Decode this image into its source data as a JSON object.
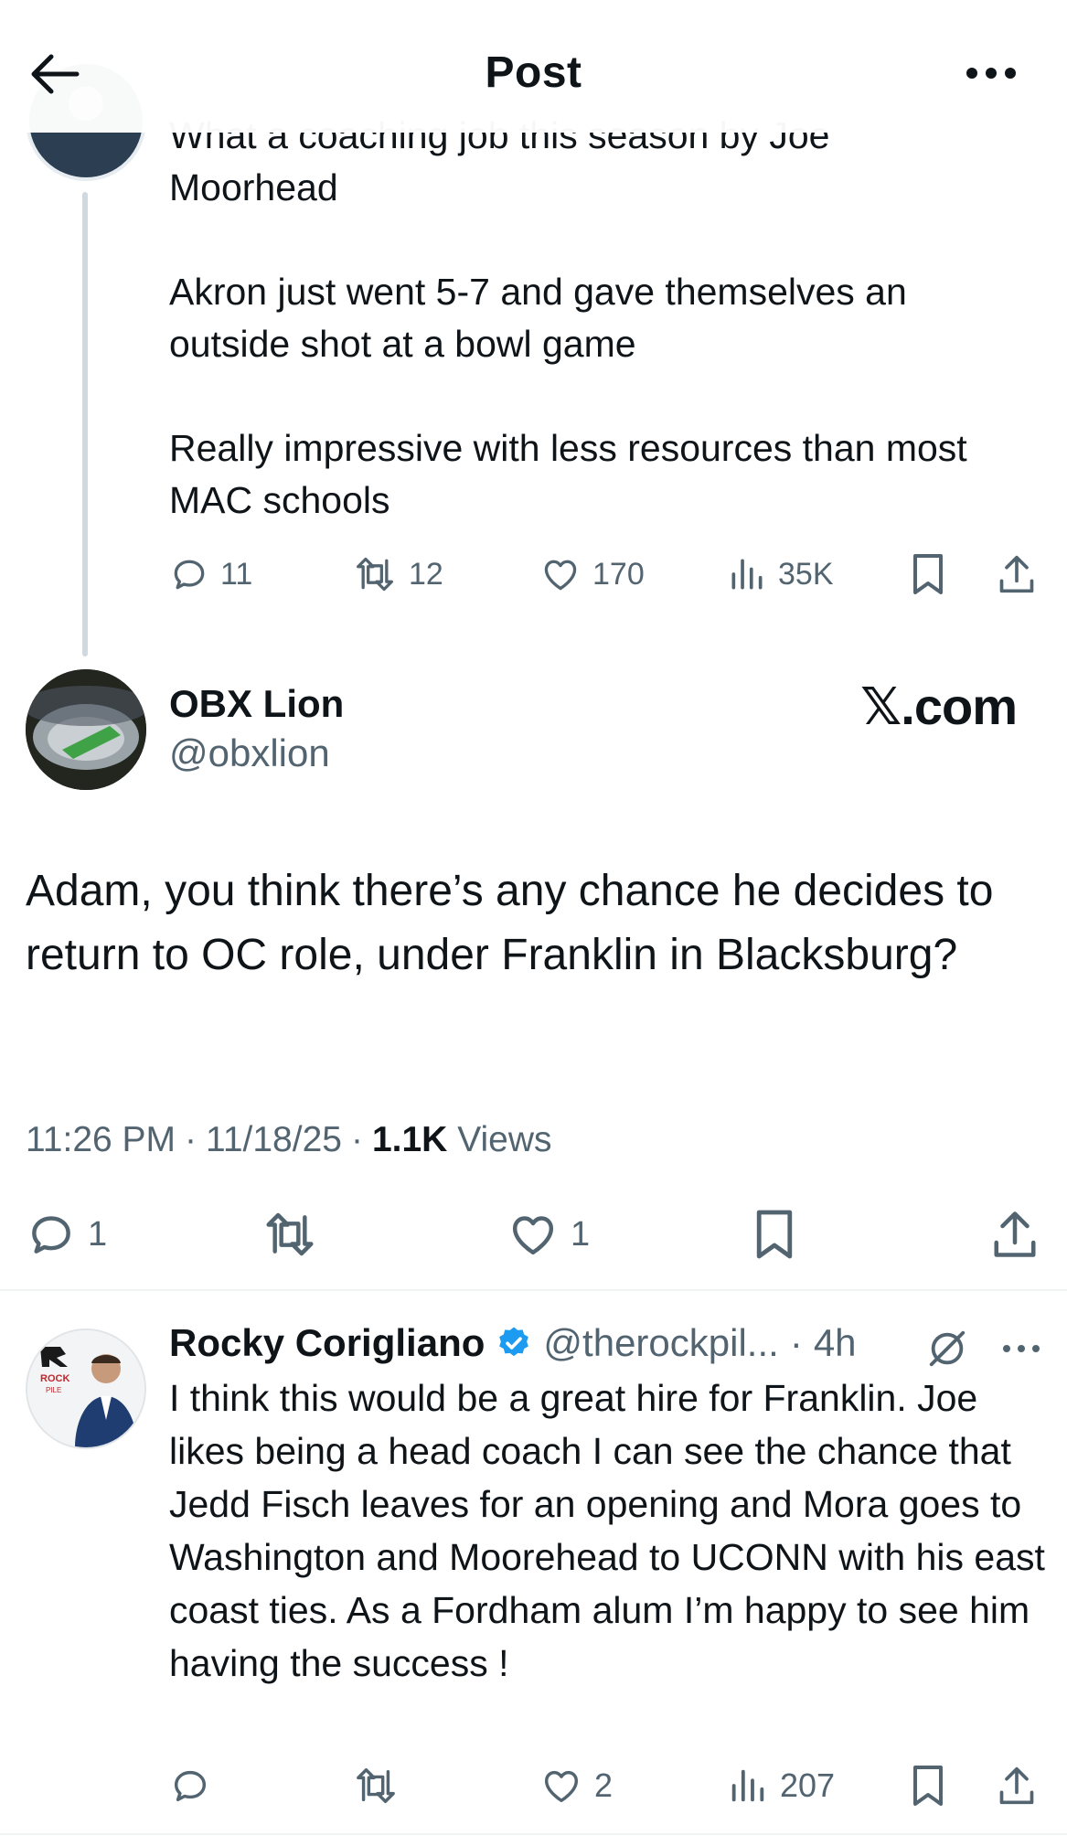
{
  "header": {
    "title": "Post"
  },
  "parent_tweet": {
    "text_lines": "What a coaching job this season by Joe\nMoorhead\n\nAkron just went 5-7 and gave themselves an\noutside shot at a bowl game\n\nReally impressive with less resources than most\nMAC schools",
    "stats": {
      "replies": "11",
      "reposts": "12",
      "likes": "170",
      "views": "35K"
    }
  },
  "focused_tweet": {
    "display_name": "OBX Lion",
    "handle": "@obxlion",
    "brand": "𝕏.com",
    "text": "Adam, you think there’s any chance he decides to return to OC role, under Franklin in Blacksburg?",
    "time": "11:26 PM",
    "date": "11/18/25",
    "views_count": "1.1K",
    "views_label": "Views",
    "sep": "·",
    "stats": {
      "replies": "1",
      "likes": "1"
    }
  },
  "reply_tweet": {
    "display_name": "Rocky Corigliano",
    "handle": "@therockpil...",
    "age": "4h",
    "sep": "·",
    "text": "I think this would be a great hire for Franklin. Joe likes being a head coach I can see the chance that Jedd Fisch leaves for an opening and Mora goes to Washington and Moorehead to UCONN with his east coast ties. As a Fordham alum I’m happy to see him having the success !",
    "stats": {
      "likes": "2",
      "views": "207"
    },
    "avatar_logo": [
      "ROCK",
      "PILE"
    ]
  },
  "colors": {
    "text": "#0f1419",
    "secondary": "#536471",
    "verified": "#1d9bf0",
    "divider": "#eff3f4",
    "thread_line": "#cfd9de"
  },
  "icons": [
    "back-arrow-icon",
    "more-icon",
    "reply-icon",
    "repost-icon",
    "like-icon",
    "views-icon",
    "bookmark-icon",
    "share-icon",
    "verified-icon",
    "grok-icon"
  ]
}
